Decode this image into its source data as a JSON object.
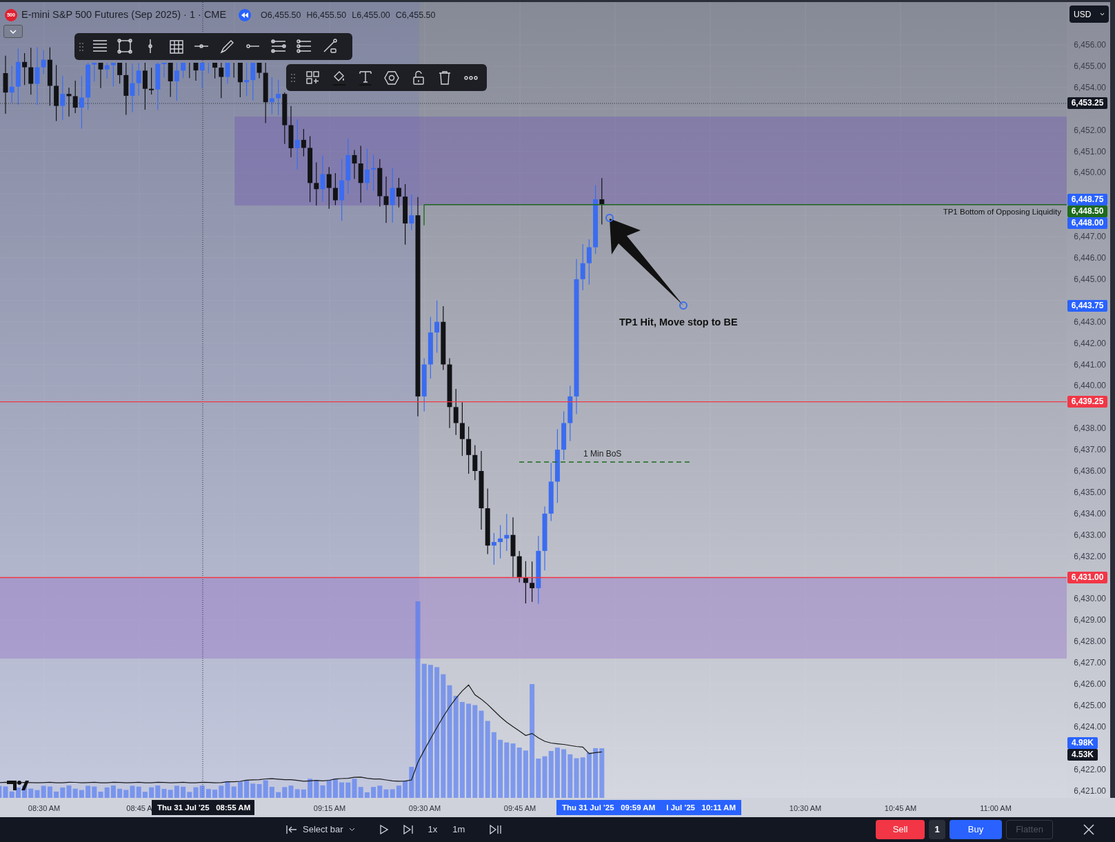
{
  "legend": {
    "symbol_badge": "500",
    "title": "E-mini S&P 500 Futures (Sep 2025) · 1 · CME",
    "ohlc": [
      "O6,455.50",
      "H6,455.50",
      "L6,455.00",
      "C6,455.50"
    ]
  },
  "currency": "USD",
  "annotations": {
    "target_label": "TP1 Bottom of Opposing Liquidity",
    "arrow_note": "TP1 Hit, Move stop to BE",
    "break_label": "1 Min BoS"
  },
  "price_axis": {
    "labels": [
      "6,456.00",
      "6,455.00",
      "6,454.00",
      "6,452.00",
      "6,451.00",
      "6,450.00",
      "6,447.00",
      "6,446.00",
      "6,445.00",
      "6,443.00",
      "6,442.00",
      "6,441.00",
      "6,440.00",
      "6,438.00",
      "6,437.00",
      "6,436.00",
      "6,435.00",
      "6,434.00",
      "6,433.00",
      "6,432.00",
      "6,430.00",
      "6,429.00",
      "6,428.00",
      "6,427.00",
      "6,426.00",
      "6,425.00",
      "6,424.00",
      "6,422.00",
      "6,421.00"
    ],
    "price_tags": [
      {
        "text": "6,453.25",
        "color": "#131722"
      },
      {
        "text": "6,448.75",
        "color": "#2962ff"
      },
      {
        "text": "6,448.50",
        "color": "#1e6b1e"
      },
      {
        "text": "6,448.00",
        "color": "#2962ff"
      },
      {
        "text": "6,443.75",
        "color": "#2962ff"
      },
      {
        "text": "6,439.25",
        "color": "#f23645"
      },
      {
        "text": "6,431.00",
        "color": "#f23645"
      }
    ],
    "volume_tags": [
      {
        "text": "4.98K",
        "color": "#2962ff"
      },
      {
        "text": "4.53K",
        "color": "#131722"
      }
    ]
  },
  "time_axis": {
    "labels": [
      "08:30 AM",
      "08:45 A",
      "09:15 AM",
      "09:30 AM",
      "09:45 AM",
      "10:30 AM",
      "10:45 AM",
      "11:00 AM"
    ],
    "crosshair_tag": "Thu 31 Jul '25   08:55 AM",
    "cursor_tags": [
      "Thu 31 Jul '25   09:59 AM",
      "l Jul '25   10:11 AM"
    ]
  },
  "bottom_bar": {
    "select_bar": "Select bar",
    "speed": "1x",
    "interval": "1m"
  },
  "trade": {
    "sell": "Sell",
    "quantity": "1",
    "buy": "Buy",
    "flatten": "Flatten",
    "flatten_disabled": true
  }
}
